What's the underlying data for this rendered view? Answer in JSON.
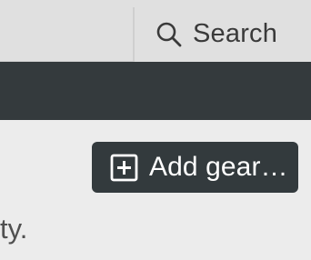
{
  "header": {
    "search_label": "Search"
  },
  "actions": {
    "add_gear_label": "Add gear…"
  },
  "content": {
    "fragment_text": "ty."
  },
  "icons": {
    "search": "search-icon",
    "add": "plus-square-icon"
  },
  "colors": {
    "topbar_bg": "#e0e0e0",
    "nav_bg": "#343a3d",
    "button_bg": "#333a3d",
    "page_bg": "#ececec"
  }
}
